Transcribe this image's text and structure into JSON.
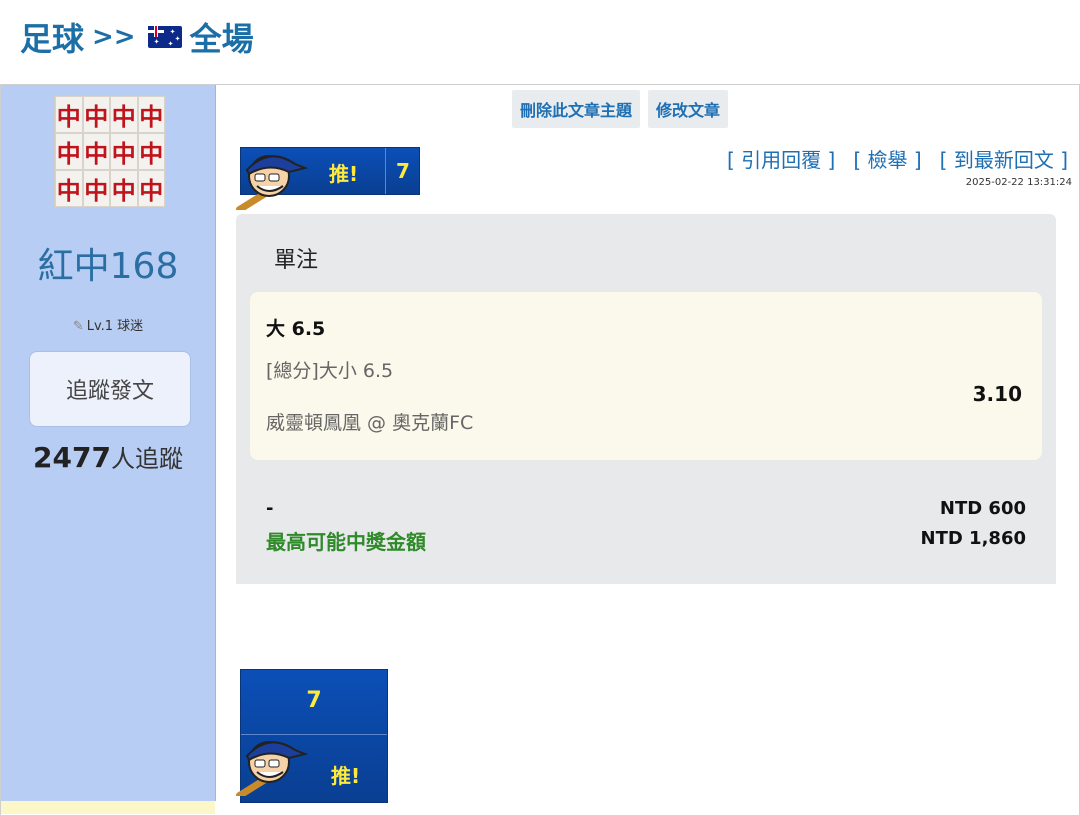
{
  "breadcrumb": {
    "sport": "足球",
    "separator": ">>",
    "place": "全場",
    "flag_icon": "australia-flag-icon"
  },
  "author": {
    "avatar_icon": "mahjong-red-dragon-avatar",
    "avatar_glyph": "中",
    "name": "紅中168",
    "level": "Lv.1 球迷",
    "follow_button": "追蹤發文",
    "followers_count": "2477",
    "followers_suffix": "人追蹤"
  },
  "post_actions": {
    "delete_topic": "刪除此文章主題",
    "edit_post": "修改文章"
  },
  "post_links": {
    "quote_reply": "[ 引用回覆 ]",
    "report": "[ 檢舉 ]",
    "latest_reply": "[ 到最新回文 ]",
    "timestamp": "2025-02-22 13:31:24"
  },
  "push": {
    "label": "推!",
    "count": "7"
  },
  "bet": {
    "type": "單注",
    "pick": "大 6.5",
    "market": "[總分]大小 6.5",
    "match": "威靈頓鳳凰 @ 奧克蘭FC",
    "odds": "3.10",
    "note": "-",
    "stake": "NTD 600",
    "max_prize_label": "最高可能中獎金額",
    "max_prize": "NTD 1,860"
  },
  "colors": {
    "accent_blue": "#1b6fa6",
    "sidebar_bg": "#b8cdf3",
    "prize_green": "#2f8a2a",
    "push_blue": "#0b4fb7",
    "push_yellow": "#ffe93b"
  }
}
